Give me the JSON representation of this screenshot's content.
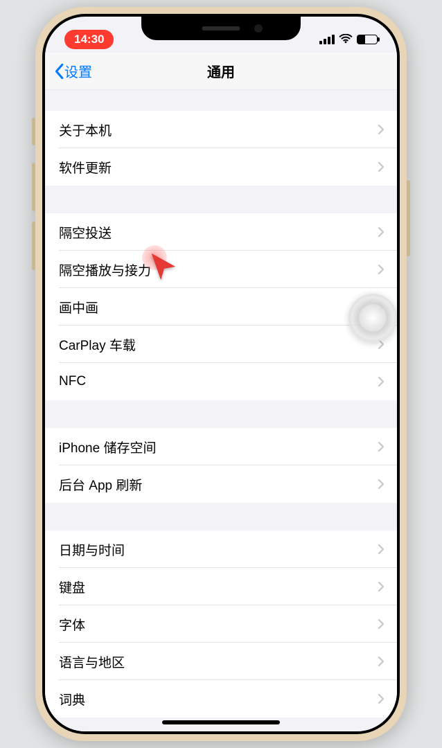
{
  "status": {
    "time": "14:30"
  },
  "nav": {
    "back": "设置",
    "title": "通用"
  },
  "groups": [
    {
      "rows": [
        {
          "key": "about",
          "label": "关于本机"
        },
        {
          "key": "update",
          "label": "软件更新"
        }
      ]
    },
    {
      "rows": [
        {
          "key": "airdrop",
          "label": "隔空投送"
        },
        {
          "key": "airplay",
          "label": "隔空播放与接力"
        },
        {
          "key": "pip",
          "label": "画中画"
        },
        {
          "key": "carplay",
          "label": "CarPlay 车载"
        },
        {
          "key": "nfc",
          "label": "NFC"
        }
      ]
    },
    {
      "rows": [
        {
          "key": "storage",
          "label": "iPhone 储存空间"
        },
        {
          "key": "refresh",
          "label": "后台 App 刷新"
        }
      ]
    },
    {
      "rows": [
        {
          "key": "datetime",
          "label": "日期与时间"
        },
        {
          "key": "keyboard",
          "label": "键盘"
        },
        {
          "key": "font",
          "label": "字体"
        },
        {
          "key": "lang",
          "label": "语言与地区"
        },
        {
          "key": "dict",
          "label": "词典"
        }
      ]
    }
  ]
}
